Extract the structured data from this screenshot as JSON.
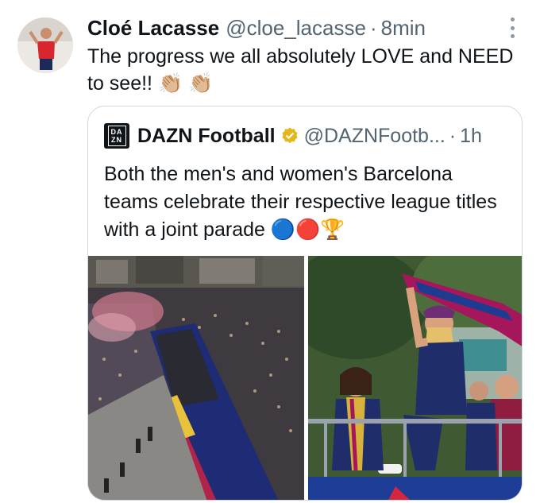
{
  "tweet": {
    "author_name": "Cloé Lacasse",
    "author_handle": "@cloe_lacasse",
    "separator": "·",
    "time": "8min",
    "text": "The progress we all absolutely LOVE and NEED to see!! 👏🏼 👏🏼",
    "more_icon": "more-vertical-icon"
  },
  "quoted_tweet": {
    "author_name": "DAZN Football",
    "author_handle": "@DAZNFootb...",
    "separator": "·",
    "time": "1h",
    "logo_text_top": "DA",
    "logo_text_bottom": "ZN",
    "verified_color": "#e2b719",
    "text": "Both the men's and women's Barcelona teams celebrate their respective league titles with a joint parade 🔵🔴🏆",
    "photos": [
      "parade-crowd-photo",
      "players-on-bus-photo"
    ]
  },
  "colors": {
    "text_primary": "#0f1419",
    "text_secondary": "#536471",
    "border": "#cfd9de"
  }
}
